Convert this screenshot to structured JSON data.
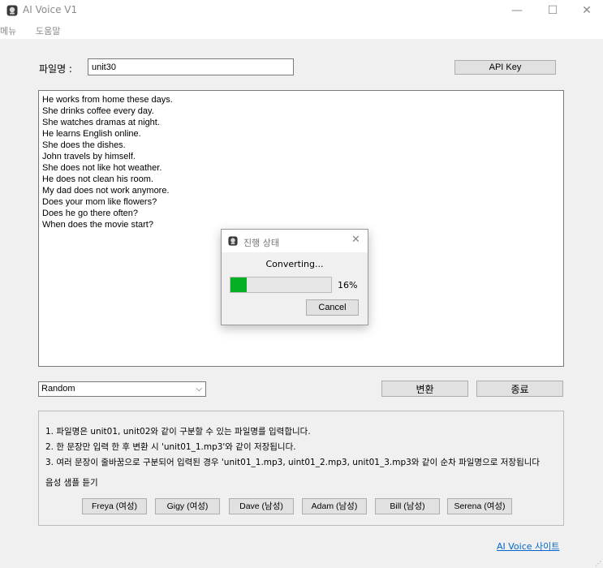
{
  "window": {
    "title": "AI Voice V1",
    "controls": {
      "minimize": "—",
      "maximize": "☐",
      "close": "✕"
    }
  },
  "menu": {
    "items": [
      "메뉴",
      "도움말"
    ]
  },
  "form": {
    "filename_label": "파일명 :",
    "filename_value": "unit30",
    "api_key_label": "API Key"
  },
  "text_lines": [
    "He works from home these days.",
    "She drinks coffee every day.",
    "She watches dramas at night.",
    "He learns English online.",
    "She does the dishes.",
    "John travels by himself.",
    "She does not like hot weather.",
    "He does not clean his room.",
    "My dad does not work anymore.",
    "Does your mom like flowers?",
    "Does he go there often?",
    "When does the movie start?"
  ],
  "voice_select": {
    "selected": "Random"
  },
  "actions": {
    "convert": "변환",
    "exit": "종료"
  },
  "info": {
    "lines": [
      "1. 파일명은 unit01, unit02와 같이 구분할 수 있는 파일명를 입력합니다.",
      "2. 한 문장만 입력 한 후 변환 시 'unit01_1.mp3'와 같이 저장됩니다.",
      "3. 여러 문장이 줄바꿈으로 구분되어 입력된 경우 'unit01_1.mp3, uint01_2.mp3, unit01_3.mp3와 같이 순차 파일명으로 저장됩니다"
    ],
    "sample_label": "음성 샘플 듣기",
    "voices": [
      "Freya (여성)",
      "Gigy (여성)",
      "Dave (남성)",
      "Adam (남성)",
      "Bill (남성)",
      "Serena (여성)"
    ]
  },
  "link": {
    "text": "AI Voice 사이트"
  },
  "dialog": {
    "title": "진행 상태",
    "status": "Converting...",
    "progress_percent": 16,
    "progress_label": "16%",
    "cancel_label": "Cancel",
    "close": "✕"
  },
  "colors": {
    "progress": "#06b025",
    "link": "#0066cc"
  }
}
